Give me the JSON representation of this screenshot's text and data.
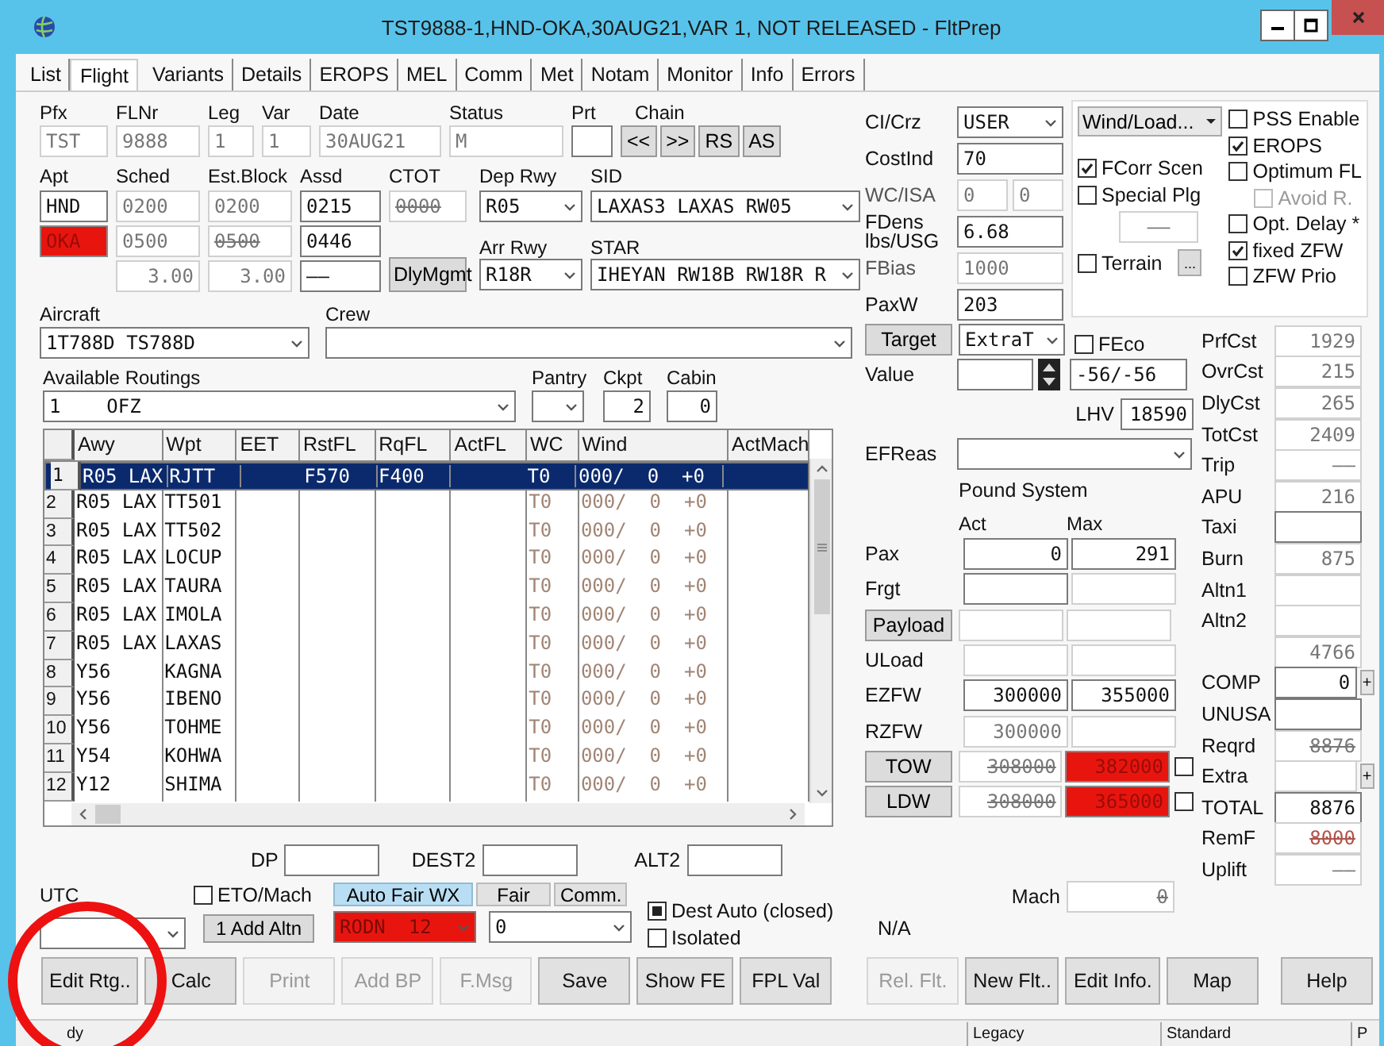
{
  "window": {
    "title": "TST9888-1,HND-OKA,30AUG21,VAR 1, NOT RELEASED - FltPrep"
  },
  "tabs": [
    {
      "label": "List",
      "selected": false
    },
    {
      "label": "Flight",
      "selected": true
    },
    {
      "label": "Variants",
      "selected": false
    },
    {
      "label": "Details",
      "selected": false
    },
    {
      "label": "EROPS",
      "selected": false
    },
    {
      "label": "MEL",
      "selected": false
    },
    {
      "label": "Comm",
      "selected": false
    },
    {
      "label": "Met",
      "selected": false
    },
    {
      "label": "Notam",
      "selected": false
    },
    {
      "label": "Monitor",
      "selected": false
    },
    {
      "label": "Info",
      "selected": false
    },
    {
      "label": "Errors",
      "selected": false
    }
  ],
  "id_fields": [
    {
      "label": "Pfx",
      "value": "TST",
      "kind": "disabled"
    },
    {
      "label": "FLNr",
      "value": "9888",
      "kind": "disabled"
    },
    {
      "label": "Leg",
      "value": "1",
      "kind": "disabled"
    },
    {
      "label": "Var",
      "value": "1",
      "kind": "disabled"
    },
    {
      "label": "Date",
      "value": "30AUG21",
      "kind": "disabled"
    },
    {
      "label": "Status",
      "value": "M",
      "kind": "disabled"
    },
    {
      "label": "Prt",
      "kind": "normal"
    }
  ],
  "chain": {
    "label": "Chain",
    "buttons": [
      "<<",
      ">>",
      "RS",
      "AS"
    ]
  },
  "times": {
    "labels": [
      "Apt",
      "Sched",
      "Est.Block",
      "Assd",
      "CTOT"
    ],
    "rows": [
      [
        {
          "value": "HND",
          "kind": "normal"
        },
        {
          "value": "0200",
          "kind": "disabled"
        },
        {
          "value": "0200",
          "kind": "disabled"
        },
        {
          "value": "0215",
          "kind": "normal"
        },
        {
          "value": "0000",
          "kind": "struck"
        }
      ],
      [
        {
          "value": "OKA",
          "kind": "alert"
        },
        {
          "value": "0500",
          "kind": "disabled"
        },
        {
          "value": "0500",
          "kind": "struck"
        },
        {
          "value": "0446",
          "kind": "normal"
        }
      ],
      [
        {
          "kind": "blank"
        },
        {
          "value": "3.00",
          "kind": "disabled"
        },
        {
          "value": "3.00",
          "kind": "disabled"
        },
        {
          "value": "——",
          "kind": "normal"
        },
        {
          "value": "DlyMgmt",
          "kind": "button"
        }
      ]
    ]
  },
  "runways": {
    "dep_label": "Dep Rwy",
    "dep": "R05",
    "sid_label": "SID",
    "sid": "LAXAS3 LAXAS RW05",
    "arr_label": "Arr Rwy",
    "arr": "R18R",
    "star_label": "STAR",
    "star": "IHEYAN RW18B RW18R R"
  },
  "aircraft": {
    "label": "Aircraft",
    "value": "1T788D TS788D"
  },
  "crew": {
    "label": "Crew"
  },
  "routings": {
    "label": "Available Routings",
    "value": "1    OFZ"
  },
  "pantry": {
    "label": "Pantry"
  },
  "ckpt": {
    "label": "Ckpt",
    "value": "2"
  },
  "cabin": {
    "label": "Cabin",
    "value": "0"
  },
  "route_table": {
    "columns": [
      "Awy",
      "Wpt",
      "EET",
      "RstFL",
      "RqFL",
      "ActFL",
      "WC",
      "Wind",
      "ActMach"
    ],
    "rows": [
      {
        "number": "1",
        "selected": true,
        "cells": [
          "R05 LAX",
          "RJTT",
          null,
          "F570",
          "F400",
          null,
          "T0",
          "000/  0  +0",
          null
        ]
      },
      {
        "number": "2",
        "selected": false,
        "cells": [
          "R05 LAX",
          "TT501",
          null,
          null,
          null,
          null,
          "T0",
          "000/  0  +0",
          null
        ]
      },
      {
        "number": "3",
        "selected": false,
        "cells": [
          "R05 LAX",
          "TT502",
          null,
          null,
          null,
          null,
          "T0",
          "000/  0  +0",
          null
        ]
      },
      {
        "number": "4",
        "selected": false,
        "cells": [
          "R05 LAX",
          "LOCUP",
          null,
          null,
          null,
          null,
          "T0",
          "000/  0  +0",
          null
        ]
      },
      {
        "number": "5",
        "selected": false,
        "cells": [
          "R05 LAX",
          "TAURA",
          null,
          null,
          null,
          null,
          "T0",
          "000/  0  +0",
          null
        ]
      },
      {
        "number": "6",
        "selected": false,
        "cells": [
          "R05 LAX",
          "IMOLA",
          null,
          null,
          null,
          null,
          "T0",
          "000/  0  +0",
          null
        ]
      },
      {
        "number": "7",
        "selected": false,
        "cells": [
          "R05 LAX",
          "LAXAS",
          null,
          null,
          null,
          null,
          "T0",
          "000/  0  +0",
          null
        ]
      },
      {
        "number": "8",
        "selected": false,
        "cells": [
          "Y56",
          "KAGNA",
          null,
          null,
          null,
          null,
          "T0",
          "000/  0  +0",
          null
        ]
      },
      {
        "number": "9",
        "selected": false,
        "cells": [
          "Y56",
          "IBENO",
          null,
          null,
          null,
          null,
          "T0",
          "000/  0  +0",
          null
        ]
      },
      {
        "number": "10",
        "selected": false,
        "cells": [
          "Y56",
          "TOHME",
          null,
          null,
          null,
          null,
          "T0",
          "000/  0  +0",
          null
        ]
      },
      {
        "number": "11",
        "selected": false,
        "cells": [
          "Y54",
          "KOHWA",
          null,
          null,
          null,
          null,
          "T0",
          "000/  0  +0",
          null
        ]
      },
      {
        "number": "12",
        "selected": false,
        "cells": [
          "Y12",
          "SHIMA",
          null,
          null,
          null,
          null,
          "T0",
          "000/  0  +0",
          null
        ]
      }
    ]
  },
  "params": [
    {
      "label": "CI/Crz",
      "kind": "select",
      "values": [
        "USER"
      ],
      "disabled": false
    },
    {
      "label": "CostInd",
      "kind": "field",
      "values": [
        "70"
      ],
      "disabled": false
    },
    {
      "label": "WC/ISA",
      "kind": "field",
      "values": [
        "0",
        "0"
      ],
      "disabled": true
    },
    {
      "label": "FDens lbs/USG",
      "kind": "field",
      "values": [
        "6.68"
      ],
      "disabled": false
    },
    {
      "label": "FBias",
      "kind": "field",
      "values": [
        "1000"
      ],
      "disabled": true
    },
    {
      "label": "PaxW",
      "kind": "field",
      "values": [
        "203"
      ],
      "disabled": false
    }
  ],
  "wind_load": {
    "menu": "Wind/Load...",
    "checks": [
      {
        "label": "FCorr Scen",
        "checked": true
      },
      {
        "label": "Special Plg",
        "checked": false
      }
    ],
    "plg_value": "——",
    "terrain": {
      "label": "Terrain",
      "checked": false
    },
    "terrain_button": "..."
  },
  "options": [
    {
      "label": "PSS Enable",
      "checked": false,
      "disabled": false
    },
    {
      "label": "EROPS",
      "checked": true,
      "disabled": false
    },
    {
      "label": "Optimum FL",
      "checked": false,
      "disabled": false,
      "children": [
        {
          "label": "Avoid R.",
          "checked": false,
          "disabled": true
        }
      ]
    },
    {
      "label": "Opt. Delay *",
      "checked": false,
      "disabled": false
    },
    {
      "label": "fixed ZFW",
      "checked": true,
      "disabled": false
    },
    {
      "label": "ZFW Prio",
      "checked": false,
      "disabled": false
    }
  ],
  "target": {
    "button": "Target",
    "value": "ExtraT"
  },
  "feco": {
    "label": "FEco",
    "checked": false
  },
  "value_field": {
    "label": "Value",
    "range": "-56/-56"
  },
  "lhv": {
    "label": "LHV",
    "value": "18590"
  },
  "efreas": {
    "label": "EFReas"
  },
  "weights": {
    "system": "Pound System",
    "columns": [
      "Act",
      "Max"
    ],
    "rows": [
      {
        "label": "Pax",
        "kind": "label",
        "act": {
          "value": "0",
          "kind": "normal"
        },
        "max": {
          "value": "291",
          "kind": "normal"
        }
      },
      {
        "label": "Frgt",
        "kind": "label",
        "act": {
          "kind": "normal"
        },
        "max": {
          "kind": "disabled"
        }
      },
      {
        "label": "Payload",
        "kind": "button",
        "act": {
          "kind": "disabled"
        },
        "max": {
          "kind": "disabled"
        }
      },
      {
        "label": "ULoad",
        "kind": "label",
        "act": {
          "kind": "disabled"
        },
        "max": {
          "kind": "disabled"
        }
      },
      {
        "label": "EZFW",
        "kind": "label",
        "act": {
          "value": "300000",
          "kind": "normal"
        },
        "max": {
          "value": "355000",
          "kind": "normal"
        }
      },
      {
        "label": "RZFW",
        "kind": "label",
        "act": {
          "value": "300000",
          "kind": "disabled"
        },
        "max": {
          "kind": "disabled"
        }
      },
      {
        "label": "TOW",
        "kind": "button",
        "act": {
          "value": "308000",
          "kind": "struck"
        },
        "max": {
          "value": "382000",
          "kind": "alert"
        },
        "check": {
          "checked": false
        }
      },
      {
        "label": "LDW",
        "kind": "button",
        "act": {
          "value": "308000",
          "kind": "struck"
        },
        "max": {
          "value": "365000",
          "kind": "alert"
        },
        "check": {
          "checked": false
        }
      }
    ]
  },
  "costs": [
    {
      "label": "PrfCst",
      "value": "1929",
      "kind": "disabled"
    },
    {
      "label": "OvrCst",
      "value": "215",
      "kind": "disabled"
    },
    {
      "label": "DlyCst",
      "value": "265",
      "kind": "disabled"
    },
    {
      "label": "TotCst",
      "value": "2409",
      "kind": "disabled"
    },
    {
      "label": "Trip",
      "value": "——",
      "kind": "disabled"
    },
    {
      "label": "APU",
      "value": "216",
      "kind": "disabled"
    },
    {
      "label": "Taxi",
      "kind": "normal"
    },
    {
      "label": "Burn",
      "value": "875",
      "kind": "disabled"
    },
    {
      "label": "Altn1",
      "kind": "disabled"
    },
    {
      "label": "Altn2",
      "kind": "disabled"
    },
    {
      "value": "4766",
      "kind": "disabled"
    },
    {
      "label": "COMP",
      "value": "0",
      "kind": "normal",
      "plus": "+"
    },
    {
      "label": "UNUSA",
      "kind": "normal"
    },
    {
      "label": "Reqrd",
      "value": "8876",
      "kind": "struck"
    },
    {
      "label": "Extra",
      "kind": "disabled",
      "plus": "+"
    },
    {
      "label": "TOTAL",
      "value": "8876",
      "kind": "normal"
    },
    {
      "label": "RemF",
      "value": "8000",
      "kind": "warn"
    },
    {
      "label": "Uplift",
      "value": "——",
      "kind": "disabled"
    }
  ],
  "destinations": [
    {
      "label": "DP"
    },
    {
      "label": "DEST2"
    },
    {
      "label": "ALT2"
    }
  ],
  "utc": {
    "label": "UTC"
  },
  "eto_mach": {
    "label": "ETO/Mach",
    "checked": false
  },
  "add_altn": "1 Add Altn",
  "wx_buttons": [
    {
      "label": "Auto Fair WX",
      "selected": true
    },
    {
      "label": "Fair",
      "selected": false
    },
    {
      "label": "Comm.",
      "selected": false
    }
  ],
  "wx_station": {
    "value": "RODN  12",
    "alert": true
  },
  "count": {
    "value": "0"
  },
  "dest_auto": {
    "label": "Dest Auto (closed)",
    "checked": true
  },
  "isolated": {
    "label": "Isolated",
    "checked": false
  },
  "na": "N/A",
  "mach": {
    "label": "Mach",
    "value": "0",
    "kind": "struck"
  },
  "actions_left": [
    {
      "label": "Edit Rtg..",
      "disabled": false
    },
    {
      "label": "Calc",
      "disabled": false
    },
    {
      "label": "Print",
      "disabled": true
    },
    {
      "label": "Add BP",
      "disabled": true
    },
    {
      "label": "F.Msg",
      "disabled": true
    },
    {
      "label": "Save",
      "disabled": false
    },
    {
      "label": "Show FE",
      "disabled": false
    },
    {
      "label": "FPL Val",
      "disabled": false
    }
  ],
  "actions_right": [
    {
      "label": "Rel. Flt.",
      "disabled": true
    },
    {
      "label": "New Flt..",
      "disabled": false
    },
    {
      "label": "Edit Info.",
      "disabled": false
    },
    {
      "label": "Map",
      "disabled": false
    }
  ],
  "help": "Help",
  "status_bar": [
    "dy",
    "Legacy",
    "Standard",
    "P"
  ]
}
